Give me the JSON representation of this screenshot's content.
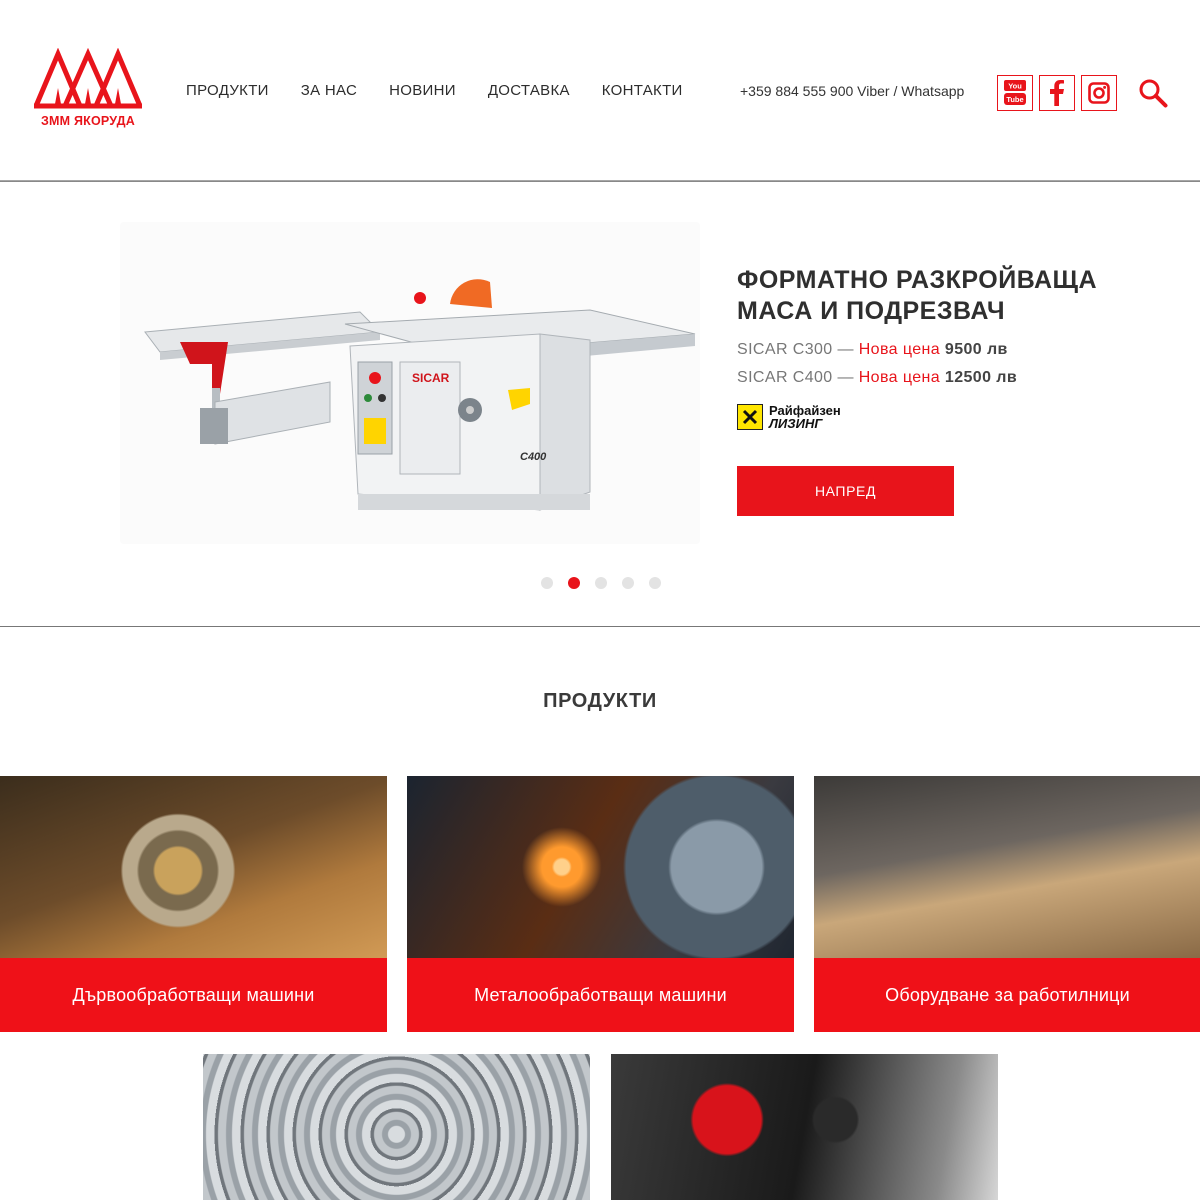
{
  "brand": {
    "name": "ЗММ ЯКОРУДА",
    "accent_color": "#e8141b"
  },
  "nav": {
    "items": [
      {
        "label": "ПРОДУКТИ"
      },
      {
        "label": "ЗА НАС"
      },
      {
        "label": "НОВИНИ"
      },
      {
        "label": "ДОСТАВКА"
      },
      {
        "label": "КОНТАКТИ"
      }
    ],
    "phone": "+359 884 555 900 Viber / Whatsapp"
  },
  "social": {
    "youtube_icon": "youtube-icon",
    "youtube_text_top": "You",
    "youtube_text_bottom": "Tube",
    "facebook_icon": "facebook-icon",
    "instagram_icon": "instagram-icon",
    "search_icon": "search-icon"
  },
  "slider": {
    "title_line1": "ФОРМАТНО РАЗКРОЙВАЩА",
    "title_line2": "МАСА И ПОДРЕЗВАЧ",
    "prices": [
      {
        "model": "SICAR C300 —",
        "label": "Нова цена",
        "value": "9500",
        "unit": "лв"
      },
      {
        "model": "SICAR C400 —",
        "label": "Нова цена",
        "value": "12500",
        "unit": "лв"
      }
    ],
    "leasing_line1": "Райфайзен",
    "leasing_line2": "ЛИЗИНГ",
    "button_label": "НАПРЕД",
    "machine_brand": "SICAR",
    "machine_model": "C400",
    "active_slide": 2,
    "slide_count": 5
  },
  "products": {
    "title": "ПРОДУКТИ",
    "cards": [
      {
        "label": "Дървообработващи машини",
        "photo": "circular-saw-cutting-wood"
      },
      {
        "label": "Металообработващи машини",
        "photo": "metal-grinding-sparks"
      },
      {
        "label": "Оборудване за работилници",
        "photo": "carpenter-workbench-tools"
      },
      {
        "label": "",
        "photo": "steel-coils"
      },
      {
        "label": "",
        "photo": "cordless-drills"
      }
    ]
  }
}
